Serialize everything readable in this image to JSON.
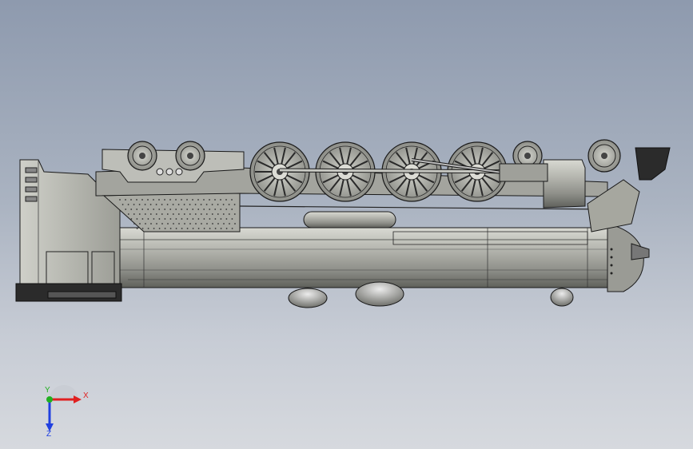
{
  "viewport": {
    "colors": {
      "bg_top": "#8e9aae",
      "bg_bottom": "#d6d9de",
      "model_body": "#b8b9b3",
      "model_dark": "#2b2b2b",
      "edge": "#1a1a1a"
    }
  },
  "triad": {
    "x_label": "X",
    "y_label": "Y",
    "z_label": "Z",
    "colors": {
      "x": "#e02020",
      "y": "#20b020",
      "z": "#2040e0"
    }
  }
}
